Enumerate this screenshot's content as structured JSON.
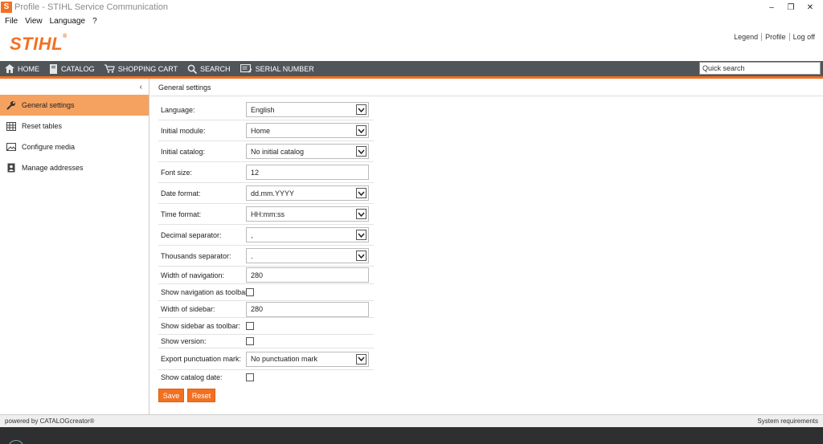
{
  "window": {
    "app_icon_letter": "S",
    "title": "Profile - STIHL Service Communication",
    "controls": [
      "–",
      "❐",
      "✕"
    ]
  },
  "menubar": {
    "items": [
      "File",
      "View",
      "Language",
      "?"
    ]
  },
  "header": {
    "logo_text": "STIHL",
    "logo_mark": "®",
    "links": [
      "Legend",
      "Profile",
      "Log off"
    ]
  },
  "nav": {
    "items": [
      {
        "label": "HOME",
        "icon": "home-icon"
      },
      {
        "label": "CATALOG",
        "icon": "catalog-icon"
      },
      {
        "label": "SHOPPING CART",
        "icon": "cart-icon"
      },
      {
        "label": "SEARCH",
        "icon": "search-icon"
      },
      {
        "label": "SERIAL NUMBER",
        "icon": "serial-number-icon"
      }
    ],
    "quick_search_placeholder": "Quick search"
  },
  "sidebar": {
    "collapse_glyph": "‹",
    "items": [
      {
        "label": "General settings",
        "icon": "wrench-icon",
        "active": true
      },
      {
        "label": "Reset tables",
        "icon": "table-icon",
        "active": false
      },
      {
        "label": "Configure media",
        "icon": "image-icon",
        "active": false
      },
      {
        "label": "Manage addresses",
        "icon": "address-book-icon",
        "active": false
      }
    ]
  },
  "main": {
    "title": "General settings",
    "fields": [
      {
        "label": "Language:",
        "type": "select",
        "value": "English"
      },
      {
        "label": "Initial module:",
        "type": "select",
        "value": "Home"
      },
      {
        "label": "Initial catalog:",
        "type": "select",
        "value": "No initial catalog"
      },
      {
        "label": "Font size:",
        "type": "text",
        "value": "12"
      },
      {
        "label": "Date format:",
        "type": "select",
        "value": "dd.mm.YYYY"
      },
      {
        "label": "Time format:",
        "type": "select",
        "value": "HH:mm:ss"
      },
      {
        "label": "Decimal separator:",
        "type": "select",
        "value": ","
      },
      {
        "label": "Thousands separator:",
        "type": "select",
        "value": "."
      },
      {
        "label": "Width of navigation:",
        "type": "text",
        "value": "280"
      },
      {
        "label": "Show navigation as toolbar:",
        "type": "checkbox",
        "checked": false
      },
      {
        "label": "Width of sidebar:",
        "type": "text",
        "value": "280"
      },
      {
        "label": "Show sidebar as toolbar:",
        "type": "checkbox",
        "checked": false
      },
      {
        "label": "Show version:",
        "type": "checkbox",
        "checked": false
      },
      {
        "label": "Export punctuation mark:",
        "type": "select",
        "value": "No punctuation mark"
      },
      {
        "label": "Show catalog date:",
        "type": "checkbox",
        "checked": false
      }
    ],
    "save_label": "Save",
    "reset_label": "Reset"
  },
  "footer": {
    "powered_by": "powered by CATALOGcreator®",
    "system_requirements": "System requirements"
  },
  "colors": {
    "accent": "#f37021",
    "nav_bg": "#50555a",
    "sidebar_active": "#f5a260"
  }
}
